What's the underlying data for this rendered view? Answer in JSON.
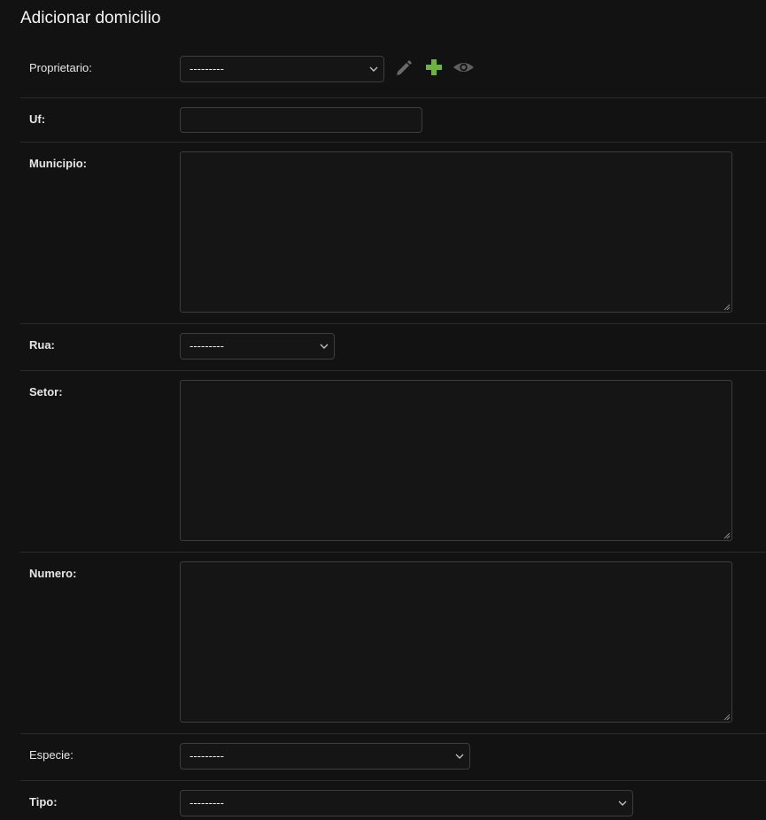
{
  "page": {
    "title": "Adicionar domicilio"
  },
  "form": {
    "proprietario": {
      "label": "Proprietario:",
      "selected": "---------",
      "actions": {
        "edit_icon": "pencil-icon",
        "add_icon": "plus-icon",
        "view_icon": "eye-icon"
      }
    },
    "uf": {
      "label": "Uf:",
      "value": ""
    },
    "municipio": {
      "label": "Municipio:",
      "value": ""
    },
    "rua": {
      "label": "Rua:",
      "selected": "---------"
    },
    "setor": {
      "label": "Setor:",
      "value": ""
    },
    "numero": {
      "label": "Numero:",
      "value": ""
    },
    "especie": {
      "label": "Especie:",
      "selected": "---------"
    },
    "tipo": {
      "label": "Tipo:",
      "selected": "---------"
    }
  },
  "colors": {
    "background": "#121212",
    "border": "#3d3d3d",
    "add_icon": "#6fb33c",
    "muted_icon": "#666666"
  }
}
